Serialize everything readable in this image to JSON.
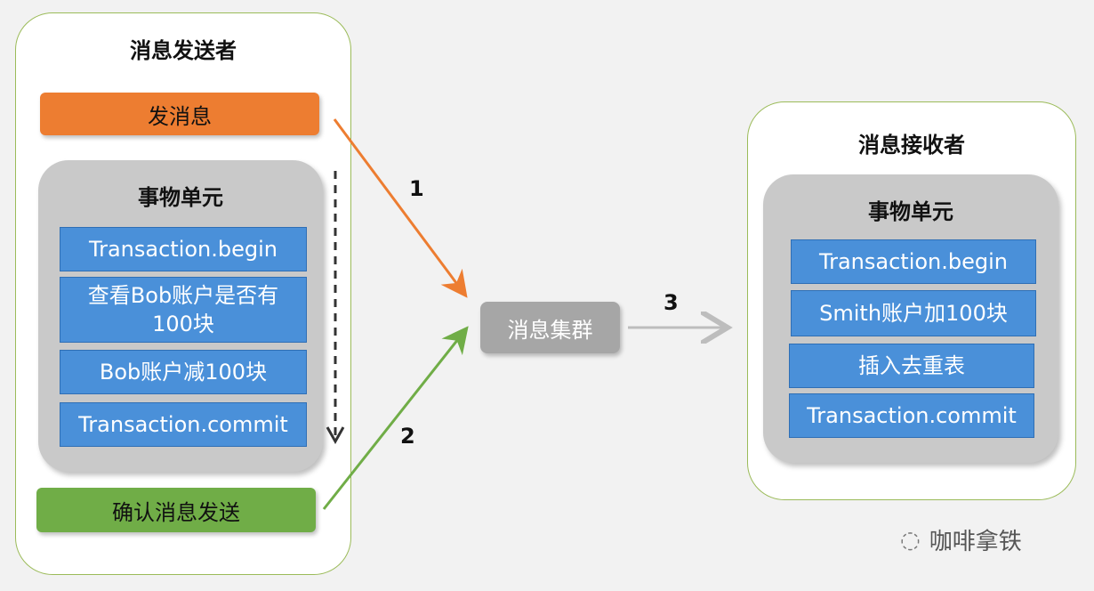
{
  "sender": {
    "title": "消息发送者",
    "send_button": "发消息",
    "confirm_button": "确认消息发送",
    "tx_title": "事物单元",
    "steps": [
      "Transaction.begin",
      "查看Bob账户是否有100块",
      "Bob账户减100块",
      "Transaction.commit"
    ]
  },
  "cluster": {
    "label": "消息集群"
  },
  "arrows": {
    "a1": "1",
    "a2": "2",
    "a3": "3"
  },
  "receiver": {
    "title": "消息接收者",
    "tx_title": "事物单元",
    "steps": [
      "Transaction.begin",
      "Smith账户加100块",
      "插入去重表",
      "Transaction.commit"
    ]
  },
  "watermark": {
    "text": "咖啡拿铁"
  },
  "colors": {
    "send": "#ed7d31",
    "confirm": "#70ad47",
    "step_blue": "#4a90d9",
    "panel_border": "#9bbb59",
    "cluster": "#a6a6a6"
  }
}
